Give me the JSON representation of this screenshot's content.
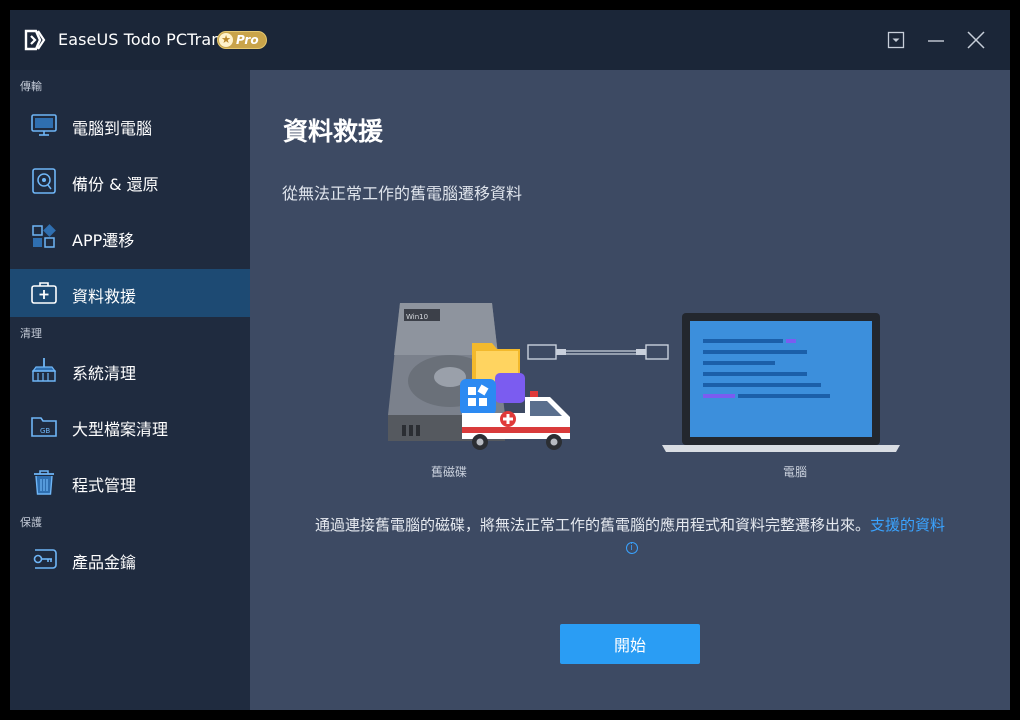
{
  "app": {
    "title": "EaseUS Todo PCTrans",
    "badge": "Pro"
  },
  "sidebar": {
    "sections": [
      {
        "label": "傳輸"
      },
      {
        "label": "清理"
      },
      {
        "label": "保護"
      }
    ],
    "items": [
      {
        "label": "電腦到電腦",
        "icon": "monitor-icon",
        "active": false
      },
      {
        "label": "備份 & 還原",
        "icon": "backup-disk-icon",
        "active": false
      },
      {
        "label": "APP遷移",
        "icon": "apps-grid-icon",
        "active": false
      },
      {
        "label": "資料救援",
        "icon": "first-aid-kit-icon",
        "active": true
      },
      {
        "label": "系統清理",
        "icon": "broom-icon",
        "active": false
      },
      {
        "label": "大型檔案清理",
        "icon": "gb-folder-icon",
        "active": false
      },
      {
        "label": "程式管理",
        "icon": "trash-can-icon",
        "active": false
      },
      {
        "label": "產品金鑰",
        "icon": "key-icon",
        "active": false
      }
    ]
  },
  "main": {
    "title": "資料救援",
    "subtitle": "從無法正常工作的舊電腦遷移資料",
    "caption_left": "舊磁碟",
    "caption_right": "電腦",
    "disk_label": "Win10",
    "description": "通過連接舊電腦的磁碟，將無法正常工作的舊電腦的應用程式和資料完整遷移出來。",
    "link_text": "支援的資料",
    "start_label": "開始"
  },
  "colors": {
    "accent": "#2a9df4",
    "sidebar_bg": "#1f2b3f",
    "active_item": "#1d4a73",
    "content_bg": "#3d4a63",
    "titlebar_bg": "#1b2638",
    "link": "#3aa3ff"
  }
}
